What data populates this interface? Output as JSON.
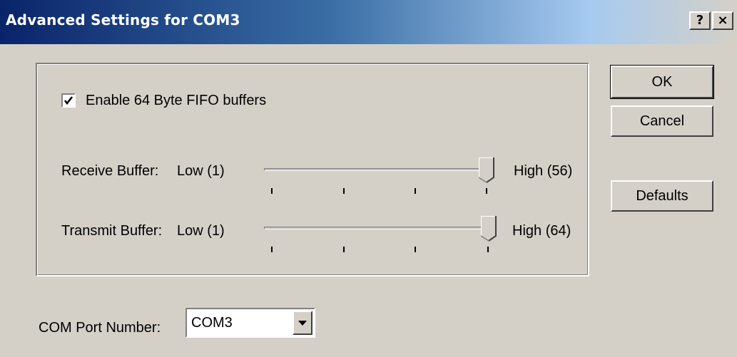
{
  "window": {
    "title": "Advanced Settings for COM3",
    "help_button": "?",
    "close_button": "×"
  },
  "fifo": {
    "checkbox_label": "Enable 64 Byte FIFO buffers",
    "checked": true
  },
  "receive_buffer": {
    "label": "Receive Buffer:",
    "low_label": "Low (1)",
    "high_label": "High (56)",
    "value": 56,
    "min": 1,
    "max": 56
  },
  "transmit_buffer": {
    "label": "Transmit Buffer:",
    "low_label": "Low (1)",
    "high_label": "High (64)",
    "value": 64,
    "min": 1,
    "max": 64
  },
  "buttons": {
    "ok": "OK",
    "cancel": "Cancel",
    "defaults": "Defaults"
  },
  "com_port": {
    "label": "COM Port Number:",
    "selected": "COM3"
  },
  "colors": {
    "face": "#d4d0c8",
    "title_active": "#0a246a",
    "title_gradient_end": "#a6caf0"
  }
}
